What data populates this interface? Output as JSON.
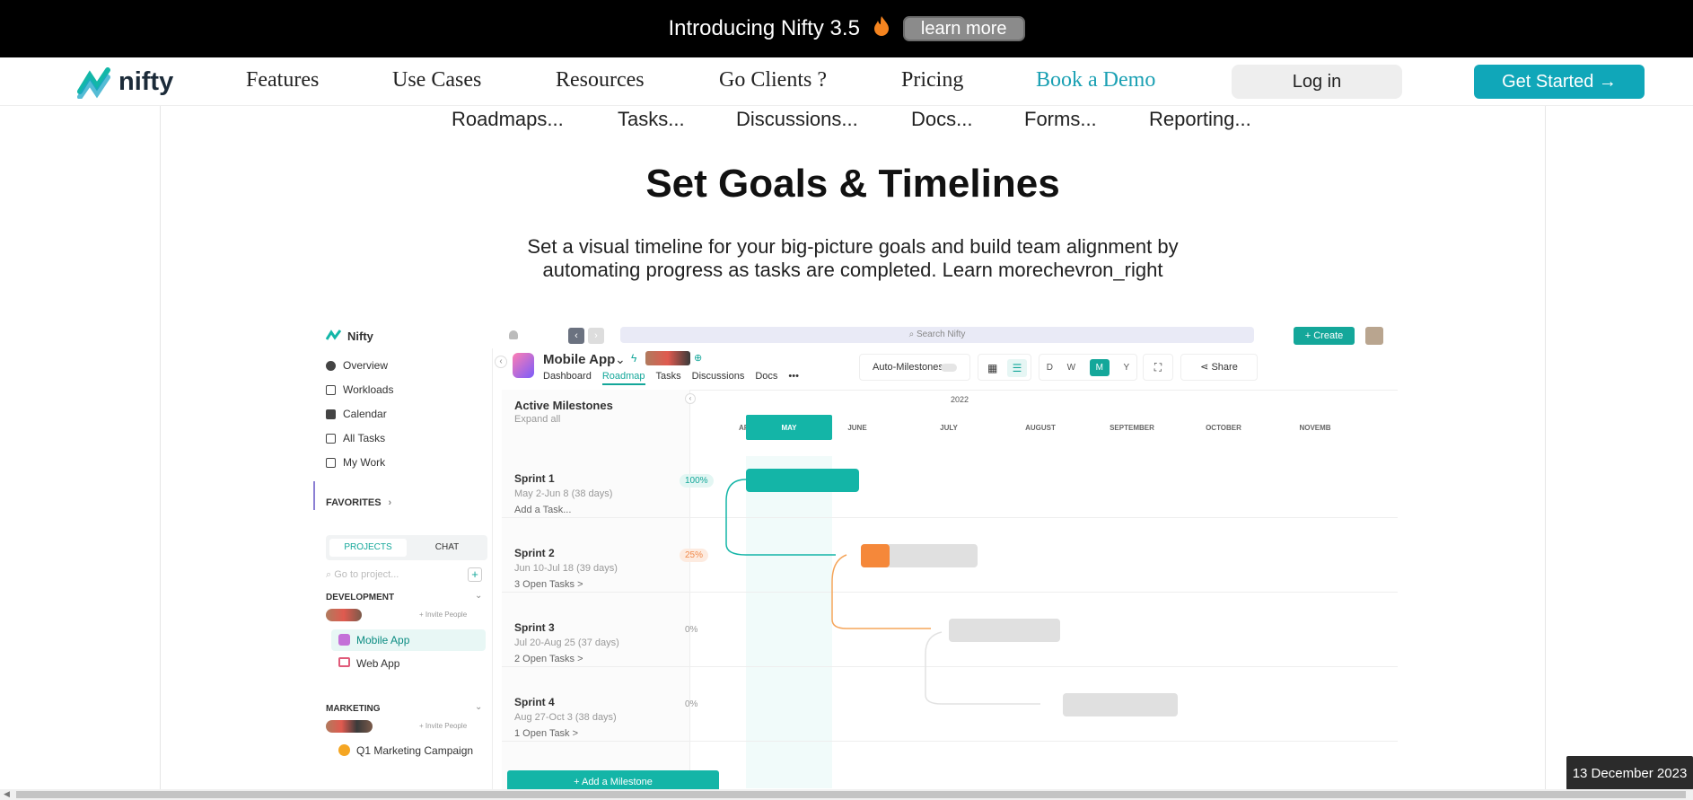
{
  "banner": {
    "text": "Introducing Nifty 3.5",
    "flame_icon": "flame-icon",
    "button": "learn more"
  },
  "nav": {
    "logo": "nifty",
    "links": [
      "Features",
      "Use Cases",
      "Resources",
      "Go Clients ?",
      "Pricing",
      "Book a Demo"
    ],
    "login": "Log in",
    "cta": "Get Started →",
    "colors": {
      "accent": "#1aa0b3",
      "cta_bg": "#10a7b9"
    }
  },
  "subnav": [
    "Roadmaps...",
    "Tasks...",
    "Discussions...",
    "Docs...",
    "Forms...",
    "Reporting..."
  ],
  "hero": {
    "title": "Set Goals & Timelines",
    "desc_line1": "Set a visual timeline for your big-picture goals and build team alignment by",
    "desc_line2": "automating progress as tasks are completed. Learn morechevron_right"
  },
  "app": {
    "brand": "Nifty",
    "search_placeholder": "Search Nifty",
    "create": "+ Create",
    "sidebar": {
      "items": [
        "Overview",
        "Workloads",
        "Calendar",
        "All Tasks",
        "My Work"
      ],
      "favorites": "FAVORITES",
      "tabs": [
        "PROJECTS",
        "CHAT"
      ],
      "search": "Go to project...",
      "groups": [
        {
          "name": "DEVELOPMENT",
          "invite": "+ Invite People",
          "projects": [
            "Mobile App",
            "Web App"
          ]
        },
        {
          "name": "MARKETING",
          "invite": "+ Invite People",
          "projects": [
            "Q1 Marketing Campaign"
          ]
        }
      ]
    },
    "project": {
      "name": "Mobile App",
      "tabs": [
        "Dashboard",
        "Roadmap",
        "Tasks",
        "Discussions",
        "Docs",
        "•••"
      ],
      "auto": "Auto-Milestones",
      "views": [
        "D",
        "W",
        "M",
        "Y"
      ],
      "share": "Share"
    },
    "milestones": {
      "header": "Active Milestones",
      "expand": "Expand all",
      "year": "2022",
      "months": [
        "APRIL",
        "MAY",
        "JUNE",
        "JULY",
        "AUGUST",
        "SEPTEMBER",
        "OCTOBER",
        "NOVEMB"
      ],
      "sprints": [
        {
          "name": "Sprint 1",
          "dates": "May 2-Jun 8 (38 days)",
          "tasks": "Add a Task...",
          "pct": "100%"
        },
        {
          "name": "Sprint 2",
          "dates": "Jun 10-Jul 18 (39 days)",
          "tasks": "3 Open Tasks >",
          "pct": "25%"
        },
        {
          "name": "Sprint 3",
          "dates": "Jul 20-Aug 25 (37 days)",
          "tasks": "2 Open Tasks >",
          "pct": "0%"
        },
        {
          "name": "Sprint 4",
          "dates": "Aug 27-Oct 3 (38 days)",
          "tasks": "1 Open Task >",
          "pct": "0%"
        }
      ],
      "add": "+ Add a Milestone"
    }
  },
  "taskbar": {
    "date": "13 December 2023"
  }
}
